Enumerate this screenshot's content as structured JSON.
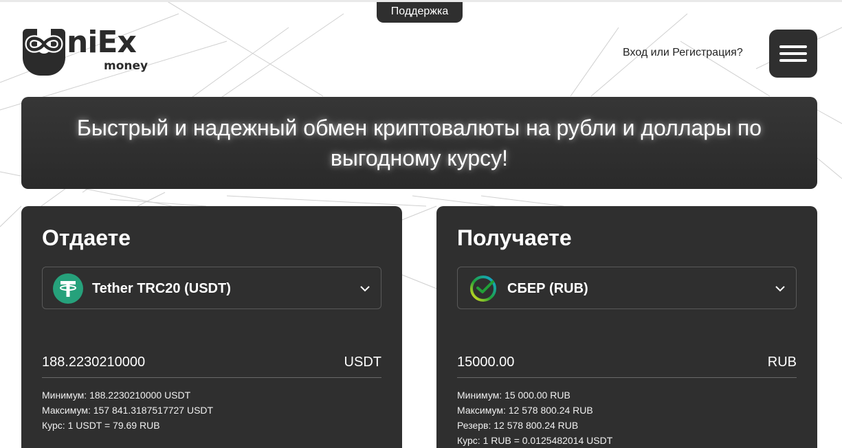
{
  "support": {
    "label": "Поддержка"
  },
  "logo": {
    "main": "niEx",
    "sub": "money"
  },
  "header": {
    "auth_label": "Вход или Регистрация?"
  },
  "hero": {
    "title": "Быстрый и надежный обмен криптовалюты на рубли и доллары по выгодному курсу!"
  },
  "give": {
    "title": "Отдаете",
    "currency": "Tether TRC20 (USDT)",
    "currency_icon": "tether-icon",
    "amount": "188.2230210000",
    "unit": "USDT",
    "info": [
      "Минимум: 188.2230210000 USDT",
      "Максимум: 157 841.3187517727 USDT",
      "Курс: 1 USDT = 79.69 RUB"
    ]
  },
  "get": {
    "title": "Получаете",
    "currency": "СБЕР (RUB)",
    "currency_icon": "sber-icon",
    "amount": "15000.00",
    "unit": "RUB",
    "info": [
      "Минимум: 15 000.00 RUB",
      "Максимум: 12 578 800.24 RUB",
      "Резерв: 12 578 800.24 RUB",
      "Курс: 1 RUB = 0.0125482014 USDT"
    ]
  },
  "colors": {
    "panel_bg": "#2f2f2f",
    "tether_green": "#26a17b",
    "sber_green": "#21a038"
  }
}
